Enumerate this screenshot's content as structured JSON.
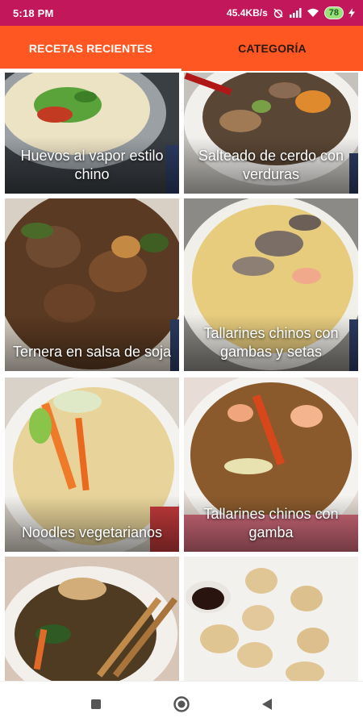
{
  "status_bar": {
    "time": "5:18 PM",
    "network_speed": "45.4KB/s",
    "battery": "78",
    "icons": [
      "alarm-off-icon",
      "signal-icon",
      "wifi-icon",
      "charging-icon"
    ]
  },
  "tabs": [
    {
      "label": "RECETAS RECIENTES",
      "active": true
    },
    {
      "label": "CATEGORÍA",
      "active": false
    }
  ],
  "recipes": [
    {
      "title": "Huevos al vapor estilo chino"
    },
    {
      "title": "Salteado de cerdo con verduras"
    },
    {
      "title": "Ternera en salsa de soja"
    },
    {
      "title": "Tallarines chinos con gambas y setas"
    },
    {
      "title": "Noodles vegetarianos"
    },
    {
      "title": "Tallarines chinos con gamba"
    },
    {
      "title": ""
    },
    {
      "title": ""
    }
  ],
  "nav": [
    "recents-icon",
    "home-icon",
    "back-icon"
  ],
  "colors": {
    "status_bar": "#c2185b",
    "tab_bar": "#ff5722",
    "tab_active_text": "#ffffff",
    "tab_inactive_text": "#2b1a12"
  }
}
